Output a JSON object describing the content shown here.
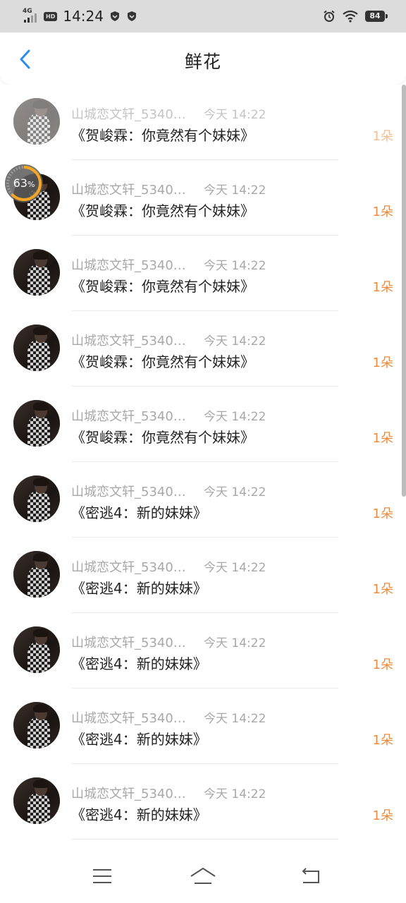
{
  "status_bar": {
    "network": "4G",
    "hd": "HD",
    "time": "14:24",
    "battery": "84"
  },
  "header": {
    "title": "鲜花"
  },
  "overlay": {
    "progress_value": "63",
    "progress_unit": "%"
  },
  "list": [
    {
      "user": "山城恋文轩_5340…",
      "time": "今天 14:22",
      "book": "《贺峻霖：你竟然有个妹妹》",
      "count": "1朵"
    },
    {
      "user": "山城恋文轩_5340…",
      "time": "今天 14:22",
      "book": "《贺峻霖：你竟然有个妹妹》",
      "count": "1朵"
    },
    {
      "user": "山城恋文轩_5340…",
      "time": "今天 14:22",
      "book": "《贺峻霖：你竟然有个妹妹》",
      "count": "1朵"
    },
    {
      "user": "山城恋文轩_5340…",
      "time": "今天 14:22",
      "book": "《贺峻霖：你竟然有个妹妹》",
      "count": "1朵"
    },
    {
      "user": "山城恋文轩_5340…",
      "time": "今天 14:22",
      "book": "《贺峻霖：你竟然有个妹妹》",
      "count": "1朵"
    },
    {
      "user": "山城恋文轩_5340…",
      "time": "今天 14:22",
      "book": "《密逃4：新的妹妹》",
      "count": "1朵"
    },
    {
      "user": "山城恋文轩_5340…",
      "time": "今天 14:22",
      "book": "《密逃4：新的妹妹》",
      "count": "1朵"
    },
    {
      "user": "山城恋文轩_5340…",
      "time": "今天 14:22",
      "book": "《密逃4：新的妹妹》",
      "count": "1朵"
    },
    {
      "user": "山城恋文轩_5340…",
      "time": "今天 14:22",
      "book": "《密逃4：新的妹妹》",
      "count": "1朵"
    },
    {
      "user": "山城恋文轩_5340…",
      "time": "今天 14:22",
      "book": "《密逃4：新的妹妹》",
      "count": "1朵"
    }
  ],
  "colors": {
    "accent_back": "#2d8cf0",
    "count": "#f08b3c",
    "progress": "#f5a623"
  },
  "icons": {
    "back": "chevron-left-icon",
    "menu": "menu-icon",
    "home": "home-icon",
    "return": "return-icon"
  }
}
